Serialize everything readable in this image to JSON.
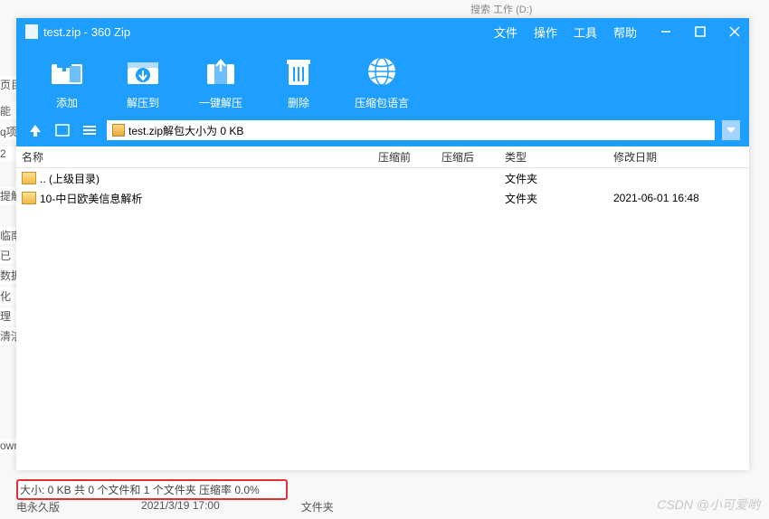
{
  "left_fragments": [
    "页目",
    "能",
    "q项",
    "2",
    "提解析",
    "临南",
    "已",
    "数据",
    "化",
    "理",
    "清洁",
    "own"
  ],
  "window": {
    "title": "test.zip - 360 Zip",
    "menu": [
      "文件",
      "操作",
      "工具",
      "帮助"
    ]
  },
  "toolbar": {
    "add": "添加",
    "extractTo": "解压到",
    "oneClick": "一键解压",
    "delete": "删除",
    "lang": "压缩包语言"
  },
  "path_text": "test.zip解包大小为 0 KB",
  "columns": {
    "name": "名称",
    "pre": "压缩前",
    "post": "压缩后",
    "type": "类型",
    "date": "修改日期"
  },
  "rows": [
    {
      "name": ".. (上级目录)",
      "type": "文件夹",
      "date": ""
    },
    {
      "name": "10-中日欧美信息解析",
      "type": "文件夹",
      "date": "2021-06-01 16:48"
    }
  ],
  "status": "大小: 0 KB 共 0 个文件和 1 个文件夹 压缩率 0.0%",
  "below": {
    "a": "电永久版",
    "b": "2021/3/19 17:00",
    "c": "文件夹"
  },
  "watermark": "CSDN @小可爱哟",
  "tab_remnant": "搜索 工作 (D:)"
}
